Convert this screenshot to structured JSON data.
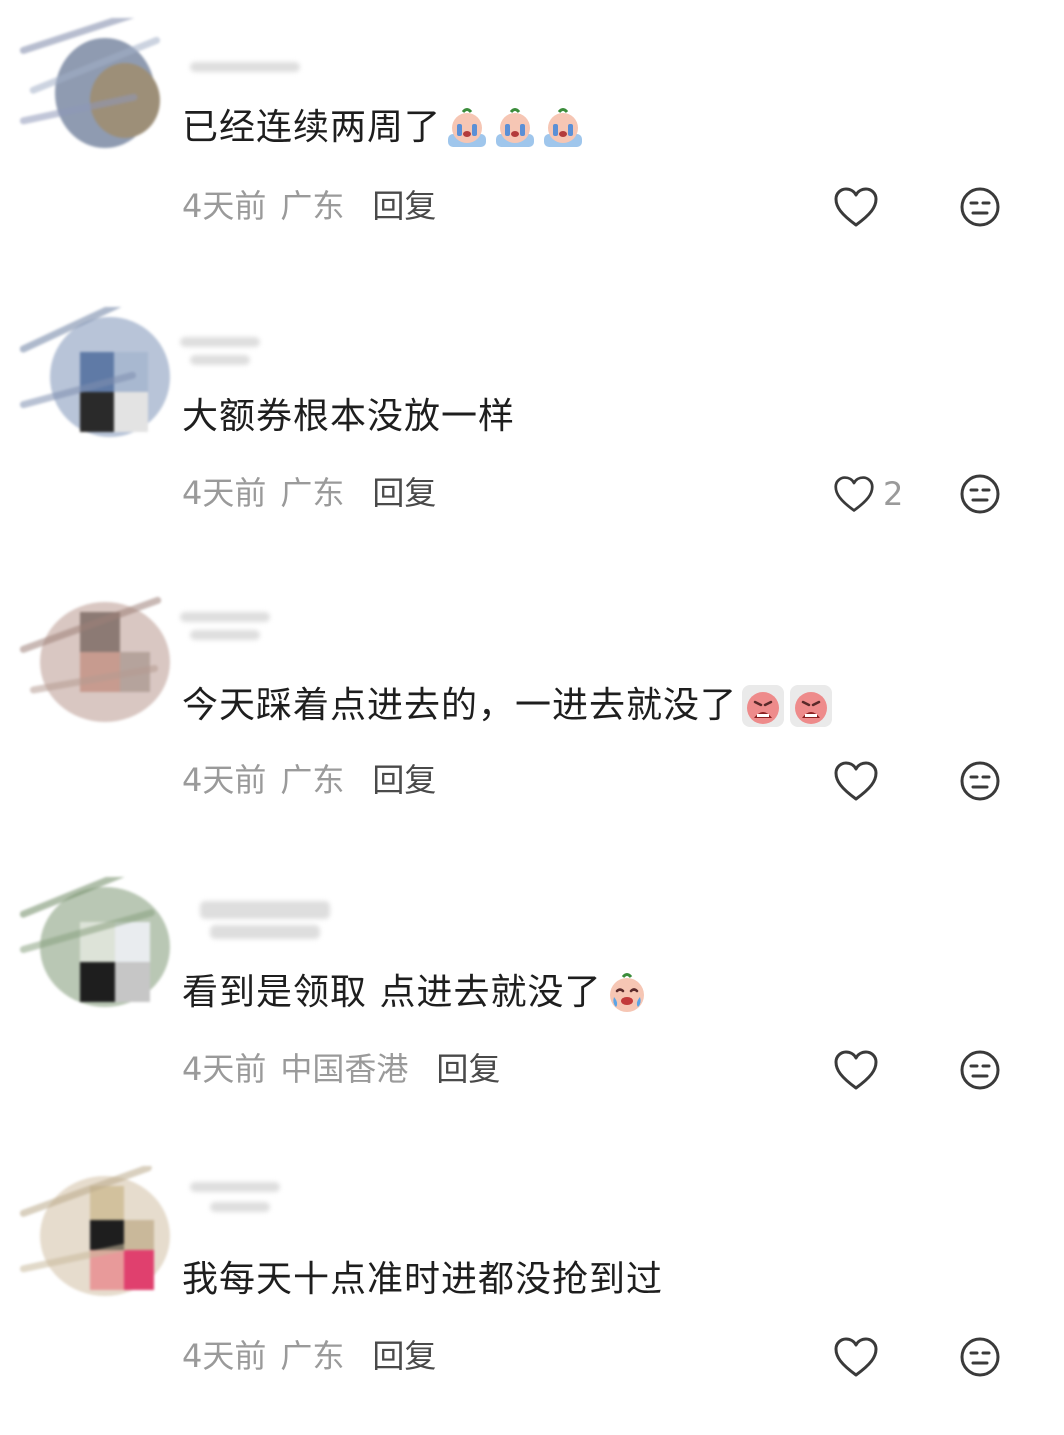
{
  "comments": [
    {
      "text": "已经连续两周了",
      "emoji": [
        "crying-face-emoji",
        "crying-face-emoji",
        "crying-face-emoji"
      ],
      "time": "4天前",
      "location": "广东",
      "reply_label": "回复",
      "like_count": ""
    },
    {
      "text": "大额券根本没放一样",
      "emoji": [],
      "time": "4天前",
      "location": "广东",
      "reply_label": "回复",
      "like_count": "2"
    },
    {
      "text": "今天踩着点进去的，一进去就没了",
      "emoji": [
        "wailing-face-emoji",
        "wailing-face-emoji"
      ],
      "time": "4天前",
      "location": "广东",
      "reply_label": "回复",
      "like_count": ""
    },
    {
      "text": "看到是领取 点进去就没了",
      "emoji": [
        "tearful-face-emoji"
      ],
      "time": "4天前",
      "location": "中国香港",
      "reply_label": "回复",
      "like_count": ""
    },
    {
      "text": "我每天十点准时进都没抢到过",
      "emoji": [],
      "time": "4天前",
      "location": "广东",
      "reply_label": "回复",
      "like_count": ""
    }
  ],
  "icons": {
    "like": "heart-outline-icon",
    "dislike": "unamused-face-icon"
  },
  "colors": {
    "text": "#1e1e1e",
    "meta": "#9a9a9a",
    "reply": "#4a4a4a",
    "icon": "#3a3a3a"
  }
}
